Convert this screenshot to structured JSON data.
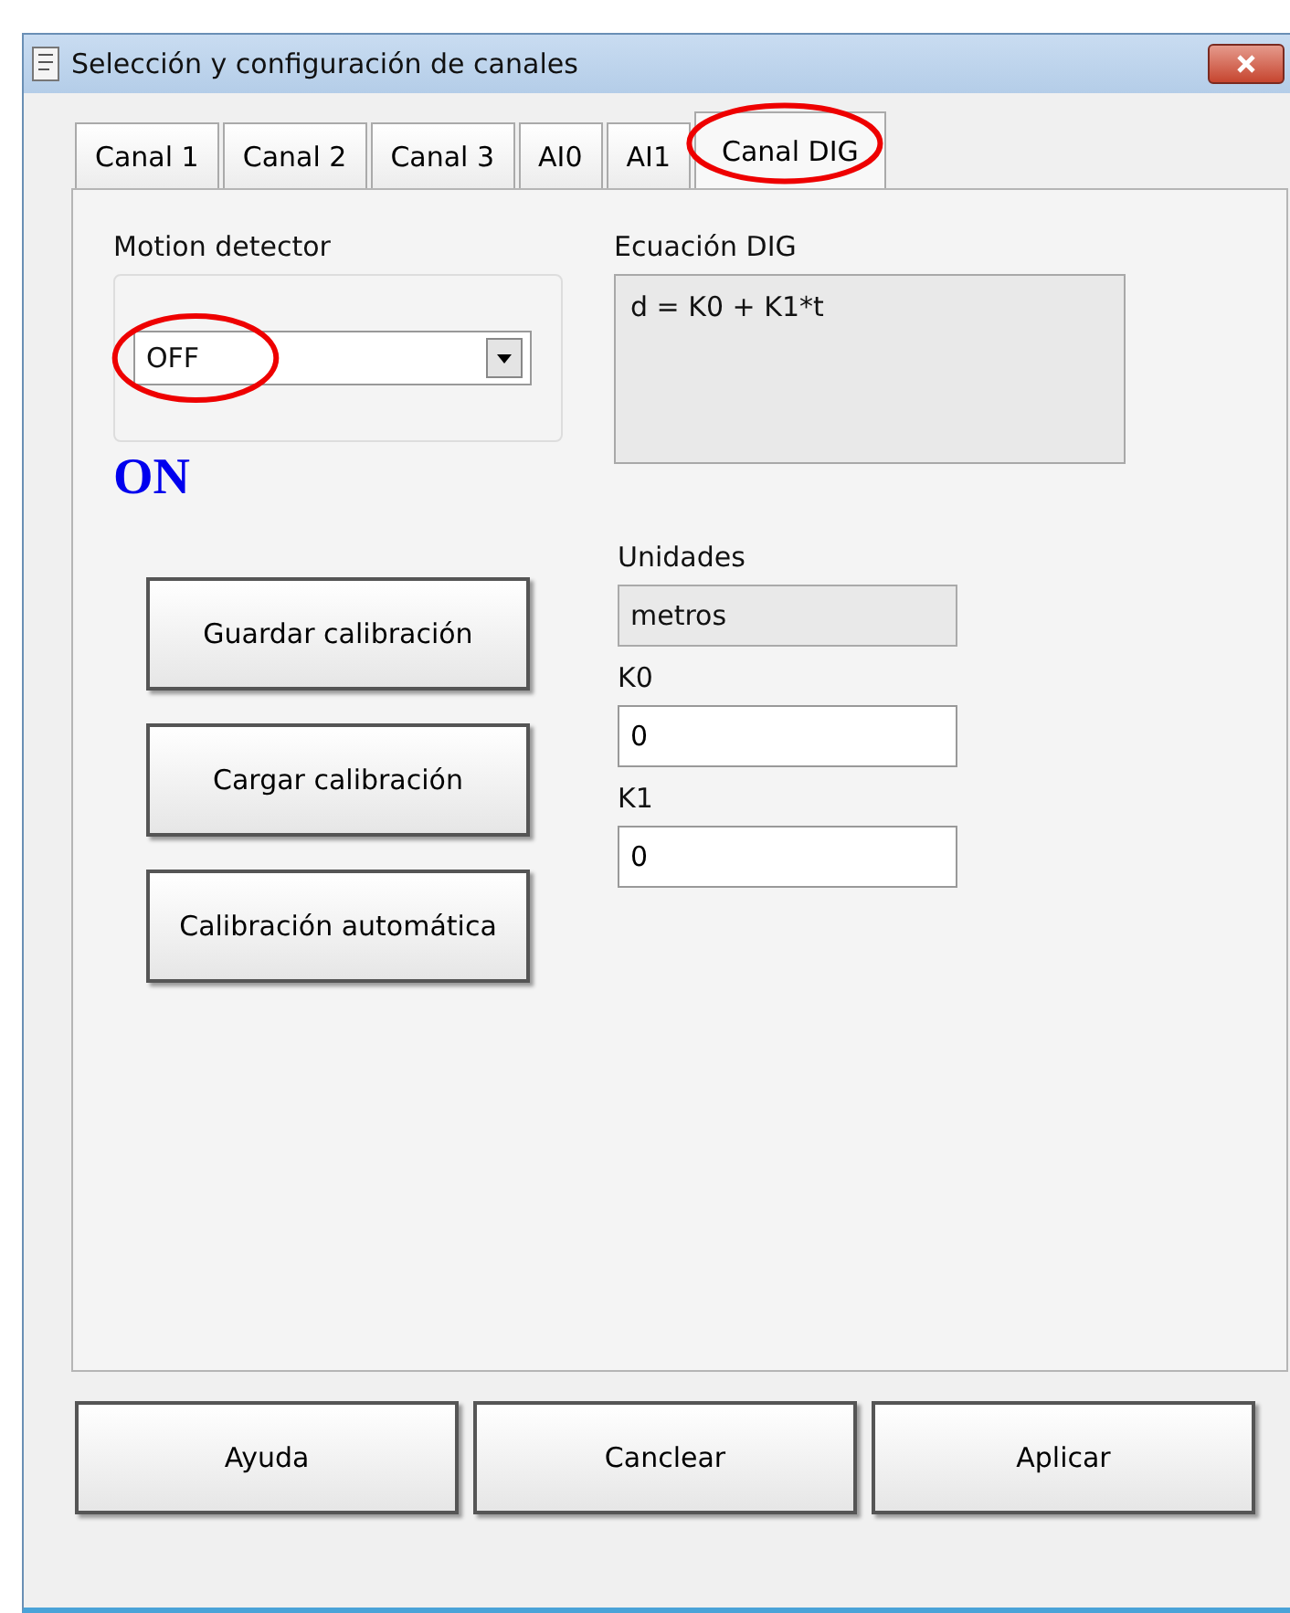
{
  "window": {
    "title": "Selección y configuración de canales"
  },
  "tabs": [
    {
      "label": "Canal 1",
      "selected": false,
      "highlighted": false
    },
    {
      "label": "Canal 2",
      "selected": false,
      "highlighted": false
    },
    {
      "label": "Canal 3",
      "selected": false,
      "highlighted": false
    },
    {
      "label": "AI0",
      "selected": false,
      "highlighted": false
    },
    {
      "label": "AI1",
      "selected": false,
      "highlighted": false
    },
    {
      "label": "Canal DIG",
      "selected": true,
      "highlighted": true
    }
  ],
  "motion_detector": {
    "label": "Motion detector",
    "value": "OFF",
    "highlighted": true,
    "annotation": "ON"
  },
  "equation": {
    "label": "Ecuación DIG",
    "value": "d = K0 + K1*t"
  },
  "calibration_buttons": [
    "Guardar calibración",
    "Cargar calibración",
    "Calibración automática"
  ],
  "fields": [
    {
      "label": "Unidades",
      "value": "metros",
      "kind": "readonly"
    },
    {
      "label": "K0",
      "value": "0",
      "kind": "input"
    },
    {
      "label": "K1",
      "value": "0",
      "kind": "input"
    }
  ],
  "buttons": [
    "Ayuda",
    "Canclear",
    "Aplicar"
  ]
}
